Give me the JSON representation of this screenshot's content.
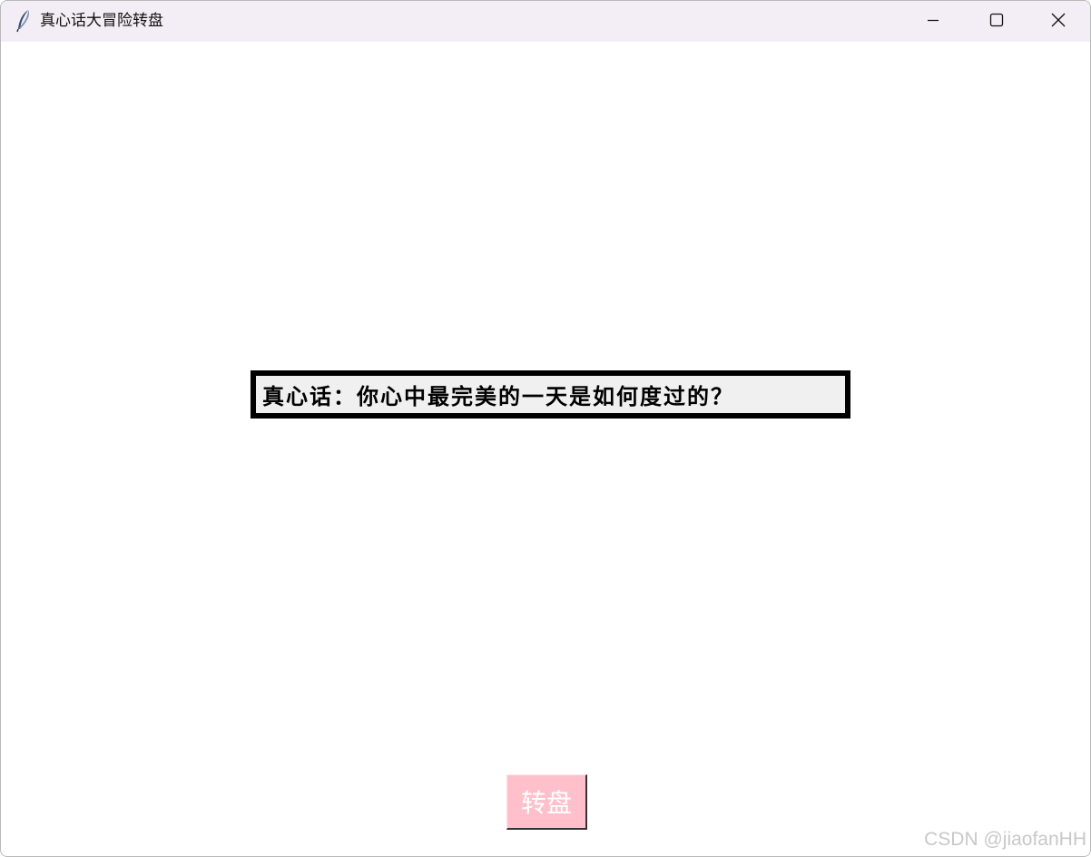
{
  "window": {
    "title": "真心话大冒险转盘",
    "icon": "feather-icon",
    "controls": {
      "minimize": "minimize-icon",
      "maximize": "maximize-icon",
      "close": "close-icon"
    }
  },
  "main": {
    "question": "真心话：你心中最完美的一天是如何度过的？",
    "spin_button_label": "转盘"
  },
  "watermark": "CSDN @jiaofanHH",
  "colors": {
    "titlebar_bg": "#f3eef6",
    "button_bg": "#ffc0cb",
    "button_text": "#ffffff",
    "label_border": "#000000",
    "label_bg": "#f0f0f0"
  }
}
